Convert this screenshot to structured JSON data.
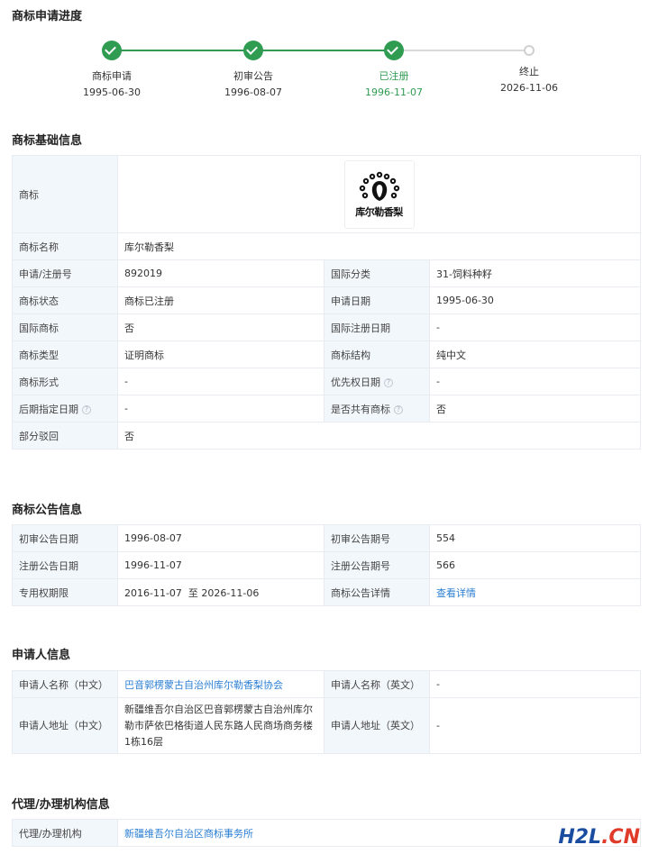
{
  "progress": {
    "title": "商标申请进度",
    "steps": [
      {
        "label": "商标申请",
        "date": "1995-06-30"
      },
      {
        "label": "初审公告",
        "date": "1996-08-07"
      },
      {
        "label": "已注册",
        "date": "1996-11-07"
      },
      {
        "label": "终止",
        "date": "2026-11-06"
      }
    ],
    "accent": "#2f9c52"
  },
  "basic": {
    "title": "商标基础信息",
    "logo_label": "商标",
    "logo_text": "库尔勒香梨",
    "name_label": "商标名称",
    "name": "库尔勒香梨",
    "reg_no_label": "申请/注册号",
    "reg_no": "892019",
    "class_label": "国际分类",
    "class": "31-饲料种籽",
    "status_label": "商标状态",
    "status": "商标已注册",
    "apply_date_label": "申请日期",
    "apply_date": "1995-06-30",
    "intl_label": "国际商标",
    "intl": "否",
    "intl_date_label": "国际注册日期",
    "intl_date": "-",
    "type_label": "商标类型",
    "type": "证明商标",
    "structure_label": "商标结构",
    "structure": "纯中文",
    "form_label": "商标形式",
    "form": "-",
    "priority_label": "优先权日期",
    "priority": "-",
    "later_label": "后期指定日期",
    "later": "-",
    "shared_label": "是否共有商标",
    "shared": "否",
    "partial_label": "部分驳回",
    "partial": "否"
  },
  "notice": {
    "title": "商标公告信息",
    "first_date_label": "初审公告日期",
    "first_date": "1996-08-07",
    "first_no_label": "初审公告期号",
    "first_no": "554",
    "reg_date_label": "注册公告日期",
    "reg_date": "1996-11-07",
    "reg_no_label": "注册公告期号",
    "reg_no": "566",
    "period_label": "专用权期限",
    "period": "2016-11-07  至 2026-11-06",
    "detail_label": "商标公告详情",
    "detail_link": "查看详情"
  },
  "applicant": {
    "title": "申请人信息",
    "name_cn_label": "申请人名称（中文）",
    "name_cn": "巴音郭楞蒙古自治州库尔勒香梨协会",
    "name_en_label": "申请人名称（英文）",
    "name_en": "-",
    "addr_cn_label": "申请人地址（中文）",
    "addr_cn": "新疆维吾尔自治区巴音郭楞蒙古自治州库尔勒市萨依巴格街道人民东路人民商场商务楼1栋16层",
    "addr_en_label": "申请人地址（英文）",
    "addr_en": "-"
  },
  "agent": {
    "title": "代理/办理机构信息",
    "label": "代理/办理机构",
    "value": "新疆维吾尔自治区商标事务所"
  },
  "watermark": {
    "main": "H2L",
    "suffix": ".CN"
  }
}
